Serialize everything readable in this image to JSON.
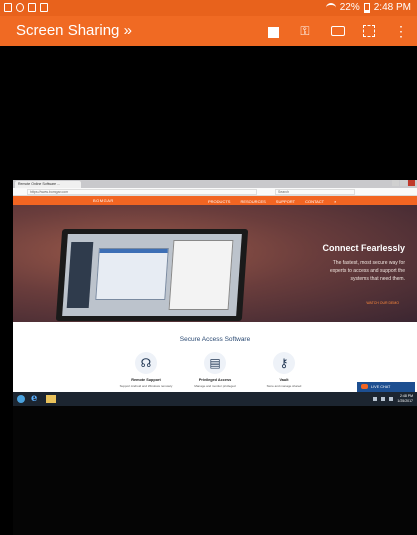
{
  "statusbar": {
    "battery": "22%",
    "time": "2:48 PM"
  },
  "appbar": {
    "title": "Screen Sharing",
    "chevron": "»"
  },
  "icons": {
    "square": "stop-icon",
    "key": "key-icon",
    "keyboard": "keyboard-icon",
    "fullscreen": "fullscreen-icon",
    "more": "more-vert-icon"
  },
  "browser": {
    "tab_label": "Remote Online Software ...",
    "url": "https://www.bomgar.com",
    "search_placeholder": "Search"
  },
  "site": {
    "logo": "BOMGAR",
    "nav": [
      "PRODUCTS",
      "RESOURCES",
      "SUPPORT",
      "CONTACT"
    ],
    "hero_title": "Connect Fearlessly",
    "hero_sub": "The fastest, most secure way for experts to access and support the systems that need them.",
    "hero_cta": "WATCH OUR DEMO",
    "section_title": "Secure Access Software",
    "features": [
      {
        "title": "Remote Support",
        "desc": "Support Android and Windows remotely"
      },
      {
        "title": "Privileged Access",
        "desc": "Manage and monitor privileged"
      },
      {
        "title": "Vault",
        "desc": "Store and manage shared"
      }
    ],
    "chat_label": "LIVE CHAT"
  },
  "taskbar": {
    "clock": "2:48 PM",
    "date": "1/25/2017"
  },
  "colors": {
    "brand": "#f06a23",
    "status": "#e8621c"
  }
}
